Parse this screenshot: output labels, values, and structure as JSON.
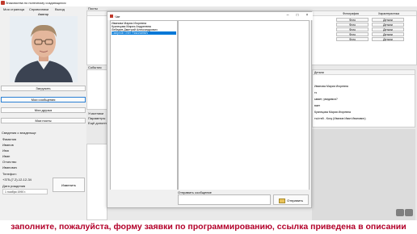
{
  "window": {
    "title": "Знакомства по полезному создающихся"
  },
  "menu": [
    "Моя страница",
    "Справочники",
    "Выход"
  ],
  "left": {
    "avatar_label": "Аватар",
    "buttons": [
      "Загрузить",
      "Мои сообщения",
      "Мои друзья",
      "Мои посты"
    ],
    "info_header": "Сведения о владельце",
    "surname_label": "Фамилия",
    "surname_value": "Иванов",
    "name_label": "Имя",
    "name_value": "Иван",
    "patronymic_label": "Отчество",
    "patronymic_value": "Иванович",
    "phone_label": "Телефон:",
    "phone_value": "+375-(7.2)-12-12-34",
    "dob_label": "Дата рождения",
    "dob_value": "1 ноября 1990 г.",
    "edit_button": "Изменить"
  },
  "main": {
    "posts_label": "Посты",
    "posts_col_photo": "Фотография",
    "posts_col_char": "Характеристика",
    "photo_button": "Фото",
    "details_button": "Детали",
    "events_label": "События",
    "nearest_label": "Участники",
    "params_label": "Параметры",
    "eee_label": "Ещё дополн",
    "right_col_header": "Детали",
    "right_rows": [
      "Иванова Мария Игоревна",
      "ть",
      "ывает, увидимся?",
      "вает",
      "Кузнецова Мария Игоревна",
      "ть/стей - Кочу (Иванов Иван Иванович)"
    ]
  },
  "chat": {
    "title": "Чат",
    "contacts": [
      "Иванова Мария Игоревна",
      "Кузнецова Мария Андреевна",
      "Лебедев Дмитрий Александрович",
      "Смирнов Олег Николаевич"
    ],
    "selected_index": 3,
    "send_label": "Отправить сообщение",
    "send_button": "Отправить"
  },
  "subtitle": "заполните, пожалуйста, форму заявки по программированию, ссылка приведена в описании",
  "colors": {
    "accent": "#0078d7",
    "subtitle": "#b3002a"
  }
}
